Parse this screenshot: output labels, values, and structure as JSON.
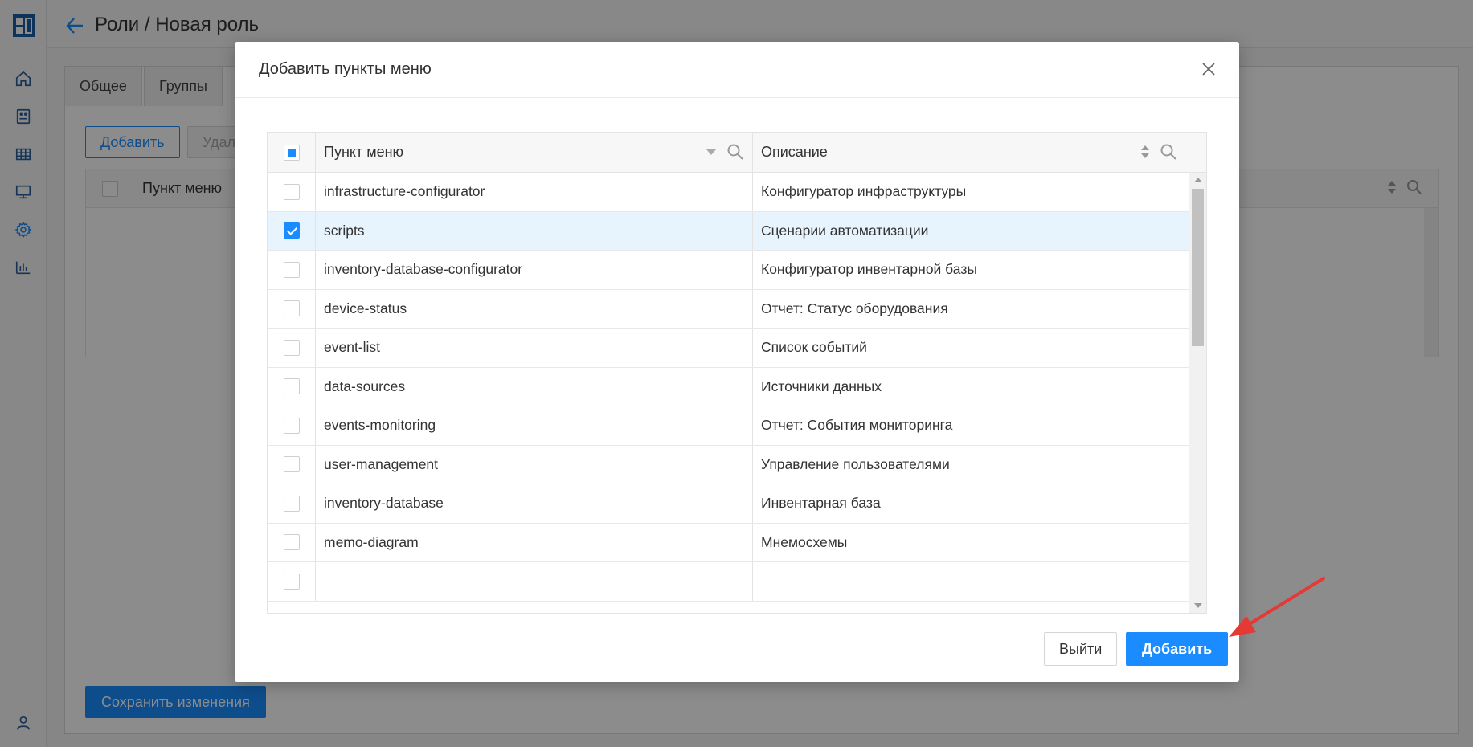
{
  "header": {
    "title": "Роли / Новая роль"
  },
  "sidebar": {
    "items": [
      "home-icon",
      "dashboard-icon",
      "table-icon",
      "monitor-icon",
      "gear-icon",
      "chart-icon"
    ],
    "active": "gear-icon",
    "bottom": "user-icon"
  },
  "background": {
    "tabs": [
      "Общее",
      "Группы"
    ],
    "add_label": "Добавить",
    "delete_label": "Удал",
    "table_header": "Пункт меню",
    "save_label": "Сохранить изменения"
  },
  "modal": {
    "title": "Добавить пункты меню",
    "columns": {
      "menu": "Пункт меню",
      "description": "Описание"
    },
    "rows": [
      {
        "menu": "infrastructure-configurator",
        "description": "Конфигуратор инфраструктуры",
        "checked": false
      },
      {
        "menu": "scripts",
        "description": "Сценарии автоматизации",
        "checked": true
      },
      {
        "menu": "inventory-database-configurator",
        "description": "Конфигуратор инвентарной базы",
        "checked": false
      },
      {
        "menu": "device-status",
        "description": "Отчет: Статус оборудования",
        "checked": false
      },
      {
        "menu": "event-list",
        "description": "Список событий",
        "checked": false
      },
      {
        "menu": "data-sources",
        "description": "Источники данных",
        "checked": false
      },
      {
        "menu": "events-monitoring",
        "description": "Отчет: События мониторинга",
        "checked": false
      },
      {
        "menu": "user-management",
        "description": "Управление пользователями",
        "checked": false
      },
      {
        "menu": "inventory-database",
        "description": "Инвентарная база",
        "checked": false
      },
      {
        "menu": "memo-diagram",
        "description": "Мнемосхемы",
        "checked": false
      }
    ],
    "exit_label": "Выйти",
    "add_label": "Добавить"
  },
  "colors": {
    "accent": "#1a8cff",
    "selected_row": "#e8f4fd",
    "arrow": "#e53935"
  }
}
